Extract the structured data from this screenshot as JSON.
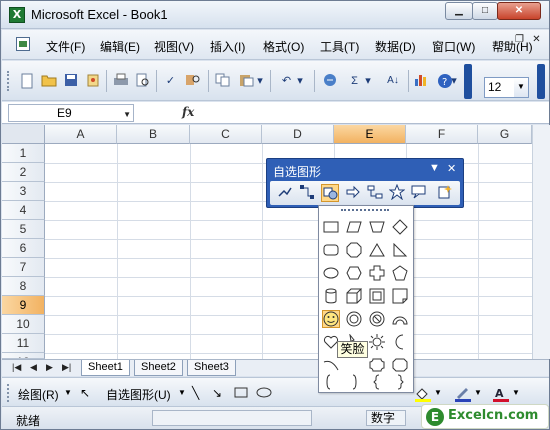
{
  "window": {
    "title": "Microsoft Excel - Book1",
    "logo_letter": "X",
    "btn_min": "▁",
    "btn_max": "□",
    "btn_close": "✕"
  },
  "menu": {
    "items": [
      "文件(F)",
      "编辑(E)",
      "视图(V)",
      "插入(I)",
      "格式(O)",
      "工具(T)",
      "数据(D)",
      "窗口(W)",
      "帮助(H)"
    ],
    "mdi_min": "_",
    "mdi_restore": "❐",
    "mdi_close": "✕"
  },
  "toolbar": {
    "font_size": "12",
    "sigma": "Σ",
    "sort_label": "A↓"
  },
  "formula": {
    "cell_ref": "E9",
    "fx": "fx"
  },
  "grid": {
    "columns": [
      "A",
      "B",
      "C",
      "D",
      "E",
      "F",
      "G"
    ],
    "selected_column": "E",
    "rows": [
      "1",
      "2",
      "3",
      "4",
      "5",
      "6",
      "7",
      "8",
      "9",
      "10",
      "11",
      "12"
    ],
    "selected_row": "9"
  },
  "sheets": {
    "tabs": [
      "Sheet1",
      "Sheet2",
      "Sheet3"
    ],
    "active": "Sheet1",
    "nav": [
      "|◀",
      "◀",
      "▶",
      "▶|"
    ]
  },
  "drawbar": {
    "draw_label": "绘图(R)",
    "autoshape_label": "自选图形(U)"
  },
  "status": {
    "ready": "就绪",
    "num": "数字"
  },
  "floating_toolbar": {
    "title": "自选图形"
  },
  "tooltip": {
    "text": "笑脸"
  },
  "watermark": {
    "logo": "E",
    "text": "Excelcn.com"
  },
  "colors": {
    "title_blue": "#2f5fb6",
    "selection_orange": "#f2b261",
    "highlight": "#ffd889"
  }
}
